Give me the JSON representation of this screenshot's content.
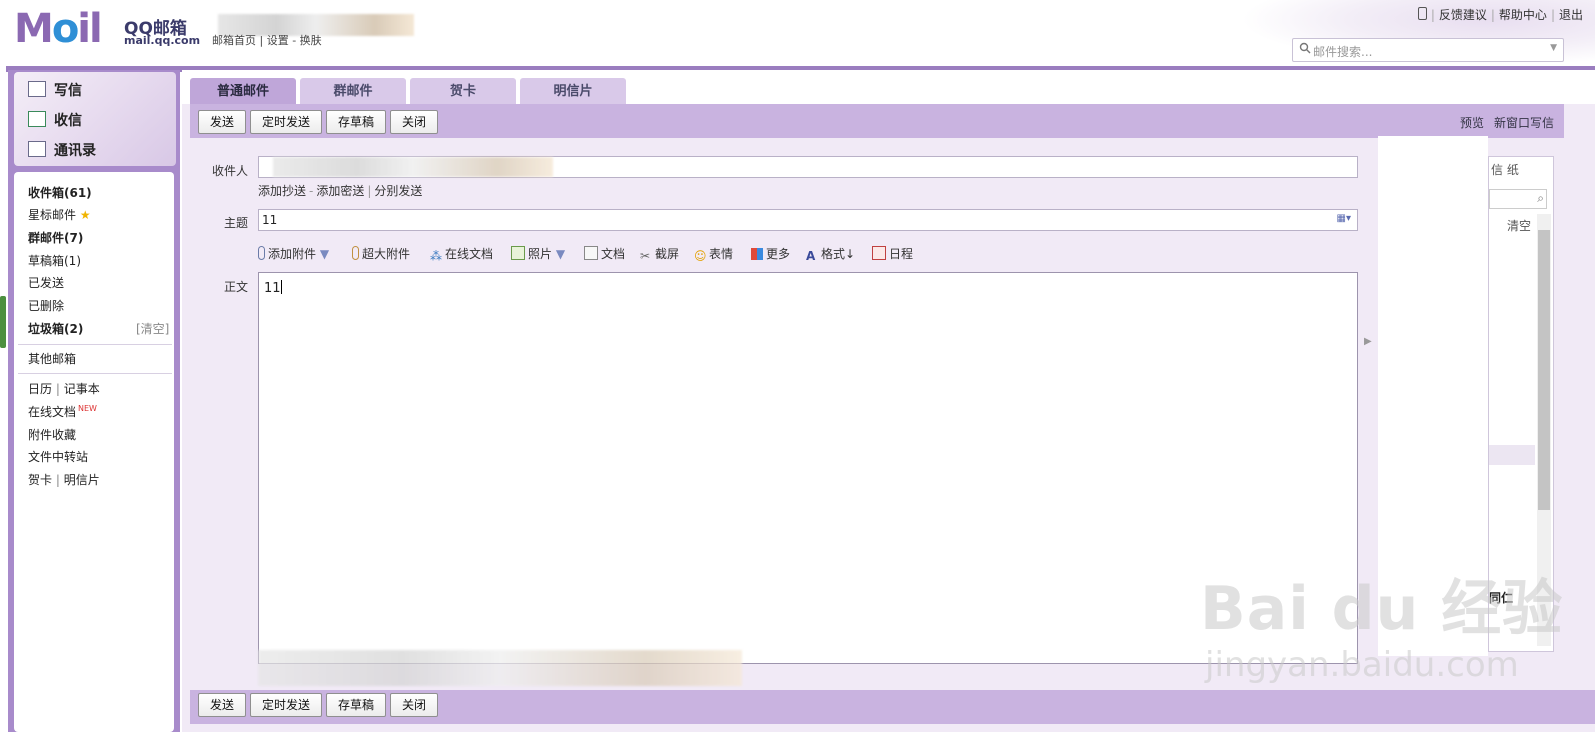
{
  "header": {
    "logo_letters": "M",
    "logo_o": "o",
    "logo_il": "il",
    "brand": "QQ邮箱",
    "domain": "mail.qq.com",
    "nav": "邮箱首页 | 设置 - 换肤",
    "links": [
      "反馈建议",
      "帮助中心",
      "退出"
    ],
    "search_placeholder": "邮件搜索..."
  },
  "actions": [
    {
      "label": "写信",
      "icon": "compose-icon"
    },
    {
      "label": "收信",
      "icon": "inbox-download-icon"
    },
    {
      "label": "通讯录",
      "icon": "contacts-icon"
    }
  ],
  "folders": [
    {
      "label": "收件箱(61)",
      "bold": true
    },
    {
      "label": "星标邮件",
      "bold": false
    },
    {
      "label": "群邮件(7)",
      "bold": true
    },
    {
      "label": "草稿箱(1)",
      "bold": false
    },
    {
      "label": "已发送",
      "bold": false
    },
    {
      "label": "已删除",
      "bold": false
    },
    {
      "label": "垃圾箱(2)",
      "bold": true
    }
  ],
  "clear_label": "[清空]",
  "other_mailbox": "其他邮箱",
  "tools": {
    "calendar": "日历",
    "notebook": "记事本",
    "online_docs": "在线文档",
    "new_badge": "NEW",
    "attachments": "附件收藏",
    "file_transfer": "文件中转站",
    "greeting": "贺卡",
    "postcard": "明信片"
  },
  "tabs": [
    "普通邮件",
    "群邮件",
    "贺卡",
    "明信片"
  ],
  "toolbar": {
    "send": "发送",
    "schedule": "定时发送",
    "draft": "存草稿",
    "close": "关闭",
    "preview": "预览",
    "new_window": "新窗口写信"
  },
  "compose": {
    "to_label": "收件人",
    "add_cc": "添加抄送",
    "add_bcc": "添加密送",
    "separate_send": "分别发送",
    "subject_label": "主题",
    "subject_value": "11",
    "body_label": "正文",
    "body_value": "11"
  },
  "editor_tools": [
    "添加附件",
    "超大附件",
    "在线文档",
    "照片",
    "文档",
    "截屏",
    "表情",
    "更多",
    "格式↓",
    "日程"
  ],
  "right_panel": {
    "stationery": "信 纸",
    "clear": "清空",
    "partial_text": "同仁"
  },
  "watermark": {
    "brand": "Bai du 经验",
    "url": "jingyan.baidu.com"
  }
}
